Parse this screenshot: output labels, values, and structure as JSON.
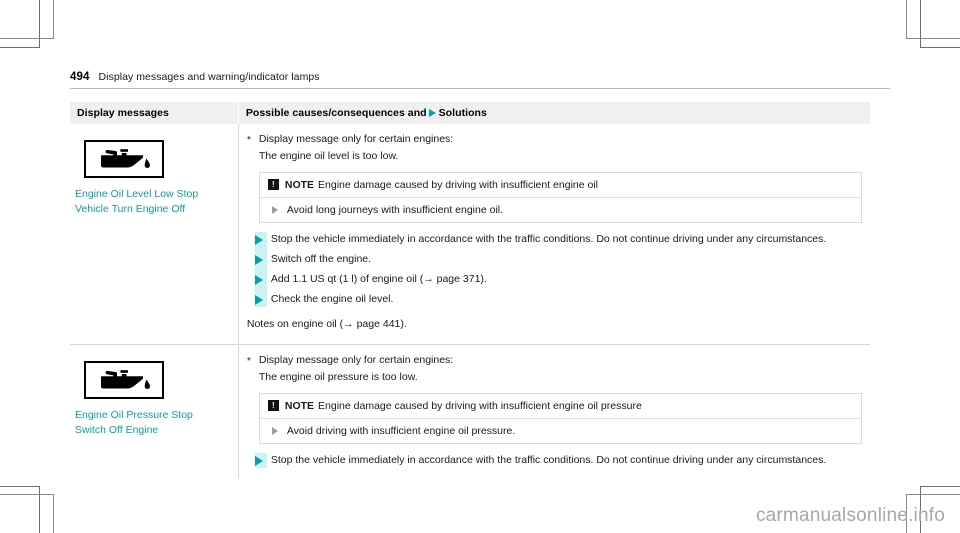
{
  "header": {
    "page_number": "494",
    "chapter_title": "Display messages and warning/indicator lamps"
  },
  "table": {
    "columns": {
      "display_messages": "Display messages",
      "solutions_prefix": "Possible causes/consequences and",
      "solutions_suffix": "Solutions",
      "solutions_marker_icon": "triangle-right-icon"
    },
    "rows": [
      {
        "lamp_icon": "oil-can-icon",
        "lamp_label": "Engine Oil Level Low Stop Vehicle Turn Engine Off",
        "asterisk": "*",
        "asterisk_text": "Display message only for certain engines:",
        "condition": "The engine oil level is too low.",
        "note": {
          "badge": "!",
          "badge_icon": "exclamation-box-icon",
          "word": "NOTE",
          "title": "Engine damage caused by driving with insufficient engine oil",
          "bullet_icon": "triangle-right-icon",
          "bullet": "Avoid long journeys with insufficient engine oil."
        },
        "actions": [
          "Stop the vehicle immediately in accordance with the traffic conditions. Do not continue driving under any circumstances.",
          "Switch off the engine.",
          "Add 1.1 US qt (1 l) of engine oil (→ page 371).",
          "Check the engine oil level."
        ],
        "trailing_note": "Notes on engine oil (→ page 441)."
      },
      {
        "lamp_icon": "oil-can-icon",
        "lamp_label": "Engine Oil Pressure Stop Switch Off Engine",
        "asterisk": "*",
        "asterisk_text": "Display message only for certain engines:",
        "condition": "The engine oil pressure is too low.",
        "note": {
          "badge": "!",
          "badge_icon": "exclamation-box-icon",
          "word": "NOTE",
          "title": "Engine damage caused by driving with insufficient engine oil pressure",
          "bullet_icon": "triangle-right-icon",
          "bullet": "Avoid driving with insufficient engine oil pressure."
        },
        "actions": [
          "Stop the vehicle immediately in accordance with the traffic conditions. Do not continue driving under any circumstances."
        ],
        "trailing_note": ""
      }
    ]
  },
  "watermark": "carmanualsonline.info",
  "colors": {
    "accent_teal": "#00a2a8",
    "lamp_label_teal": "#0f9da3",
    "action_rail_cyan": "#cdf2f4",
    "header_band_gray": "#f0f0f0",
    "rule_gray": "#d6d6d6",
    "watermark_gray": "#a8a8a8"
  }
}
